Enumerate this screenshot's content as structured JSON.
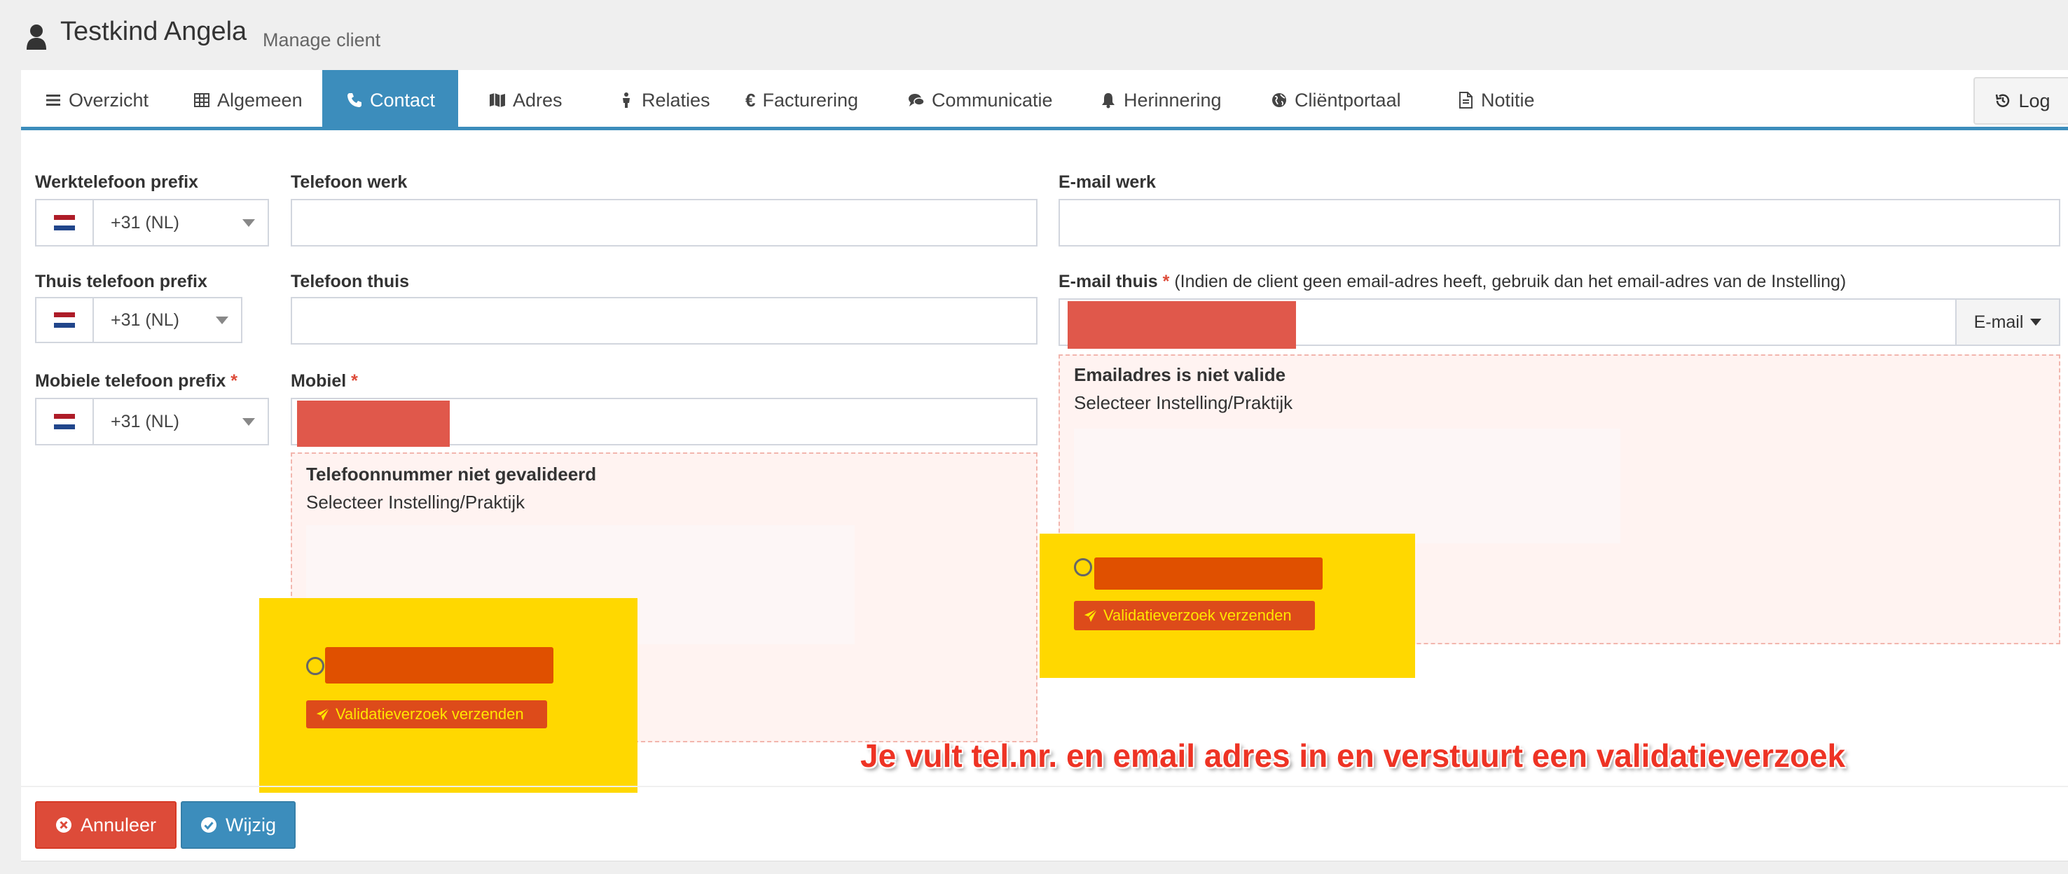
{
  "header": {
    "title": "Testkind Angela",
    "subtitle": "Manage client"
  },
  "tabs": [
    {
      "label": "Overzicht",
      "icon": "list-icon"
    },
    {
      "label": "Algemeen",
      "icon": "table-icon"
    },
    {
      "label": "Contact",
      "icon": "phone-icon",
      "active": true
    },
    {
      "label": "Adres",
      "icon": "map-icon"
    },
    {
      "label": "Relaties",
      "icon": "person-icon"
    },
    {
      "label": "Facturering",
      "icon": "euro-icon"
    },
    {
      "label": "Communicatie",
      "icon": "comments-icon"
    },
    {
      "label": "Herinnering",
      "icon": "bell-icon"
    },
    {
      "label": "Cliëntportaal",
      "icon": "globe-icon"
    },
    {
      "label": "Notitie",
      "icon": "document-icon"
    }
  ],
  "log_button": "Log",
  "form": {
    "work_prefix": {
      "label": "Werktelefoon prefix",
      "value": "+31 (NL)"
    },
    "home_prefix": {
      "label": "Thuis telefoon prefix",
      "value": "+31 (NL)"
    },
    "mobile_prefix": {
      "label": "Mobiele telefoon prefix",
      "required": "*",
      "value": "+31 (NL)"
    },
    "phone_work": {
      "label": "Telefoon werk",
      "value": ""
    },
    "phone_home": {
      "label": "Telefoon thuis",
      "value": ""
    },
    "mobile": {
      "label": "Mobiel",
      "required": "*"
    },
    "email_work": {
      "label": "E-mail werk",
      "value": ""
    },
    "email_home": {
      "label": "E-mail thuis",
      "required": "*",
      "note": "(Indien de client geen email-adres heeft, gebruik dan het email-adres van de Instelling)",
      "addon": "E-mail"
    }
  },
  "phone_validation": {
    "title": "Telefoonnummer niet gevalideerd",
    "subtitle": "Selecteer Instelling/Praktijk",
    "button": "Validatieverzoek verzenden"
  },
  "email_validation": {
    "title": "Emailadres is niet valide",
    "subtitle": "Selecteer Instelling/Praktijk",
    "button": "Validatieverzoek verzenden"
  },
  "annotation": "Je vult tel.nr. en email adres in en verstuurt een validatieverzoek",
  "footer": {
    "cancel": "Annuleer",
    "save": "Wijzig"
  },
  "colors": {
    "accent": "#3c8dbc",
    "danger": "#dd4b39",
    "highlight": "#ffd800",
    "flag_red": "#ae1c28",
    "flag_white": "#ffffff",
    "flag_blue": "#21468b"
  }
}
